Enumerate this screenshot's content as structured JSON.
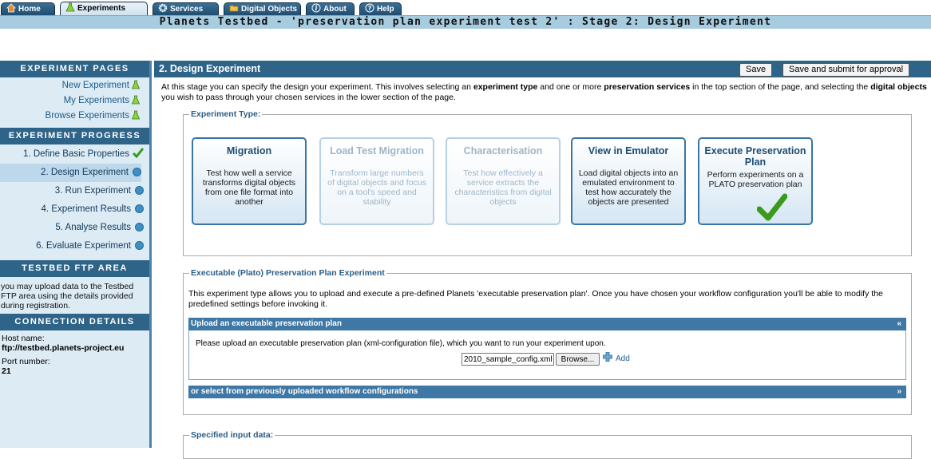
{
  "nav": {
    "tabs": [
      {
        "label": "Home",
        "icon": "home-icon"
      },
      {
        "label": "Experiments",
        "icon": "flask-icon"
      },
      {
        "label": "Services",
        "icon": "gear-icon"
      },
      {
        "label": "Digital Objects",
        "icon": "folder-icon"
      },
      {
        "label": "About",
        "icon": "info-icon"
      },
      {
        "label": "Help",
        "icon": "help-icon"
      }
    ]
  },
  "title": "Planets Testbed - 'preservation plan experiment test 2' : Stage 2: Design Experiment",
  "sidebar": {
    "pages_heading": "EXPERIMENT PAGES",
    "pages": [
      "New Experiment",
      "My Experiments",
      "Browse Experiments"
    ],
    "progress_heading": "EXPERIMENT PROGRESS",
    "progress": [
      "1. Define Basic Properties",
      "2. Design Experiment",
      "3. Run Experiment",
      "4. Experiment Results",
      "5. Analyse Results",
      "6. Evaluate Experiment"
    ],
    "ftp_heading": "TESTBED FTP AREA",
    "ftp_text": "you may upload data to the Testbed FTP area using the details provided during registration.",
    "conn_heading": "CONNECTION DETAILS",
    "host_label": "Host name:",
    "host_value": "ftp://testbed.planets-project.eu",
    "port_label": "Port number:",
    "port_value": "21"
  },
  "main": {
    "heading": "2. Design Experiment",
    "save_label": "Save",
    "submit_label": "Save and submit for approval",
    "intro_1": "At this stage you can specify the design your experiment. This involves selecting an ",
    "intro_b1": "experiment type",
    "intro_2": " and one or more ",
    "intro_b2": "preservation services",
    "intro_3": " in the top section of the page, and selecting the ",
    "intro_b3": "digital objects",
    "intro_4": " you wish to pass through your chosen services in the lower section of the page.",
    "type_legend": "Experiment Type:",
    "types": [
      {
        "title": "Migration",
        "desc": "Test how well a service transforms digital objects from one file format into another"
      },
      {
        "title": "Load Test Migration",
        "desc": "Transform large numbers of digital objects and focus on a tool's speed and stability"
      },
      {
        "title": "Characterisation",
        "desc": "Test how effectively a service extracts the characteristics from digital objects"
      },
      {
        "title": "View in Emulator",
        "desc": "Load digital objects into an emulated environment to test how accurately the objects are presented"
      },
      {
        "title": "Execute Preservation Plan",
        "desc": "Perform experiments on a PLATO preservation plan"
      }
    ],
    "plan_legend": "Executable (Plato) Preservation Plan Experiment",
    "plan_text": "This experiment type allows you to upload and execute a pre-defined Planets 'executable preservation plan'. Once you have chosen your workflow configuration you'll be able to modify the predefined settings before invoking it.",
    "upload_bar": "Upload an executable preservation plan",
    "upload_collapse": "«",
    "upload_text": "Please upload an executable preservation plan (xml-configuration file), which you want to run your experiment upon.",
    "file_value": "2010_sample_config.xml",
    "browse_label": "Browse...",
    "add_label": "Add",
    "select_bar": "or select from previously uploaded workflow configurations",
    "select_expand": "»",
    "input_legend": "Specified input data:"
  },
  "colors": {
    "header": "#2f6489",
    "title_bar": "#a7cbdf",
    "sidebar": "#dcebf4",
    "check": "#3a9a1c"
  }
}
